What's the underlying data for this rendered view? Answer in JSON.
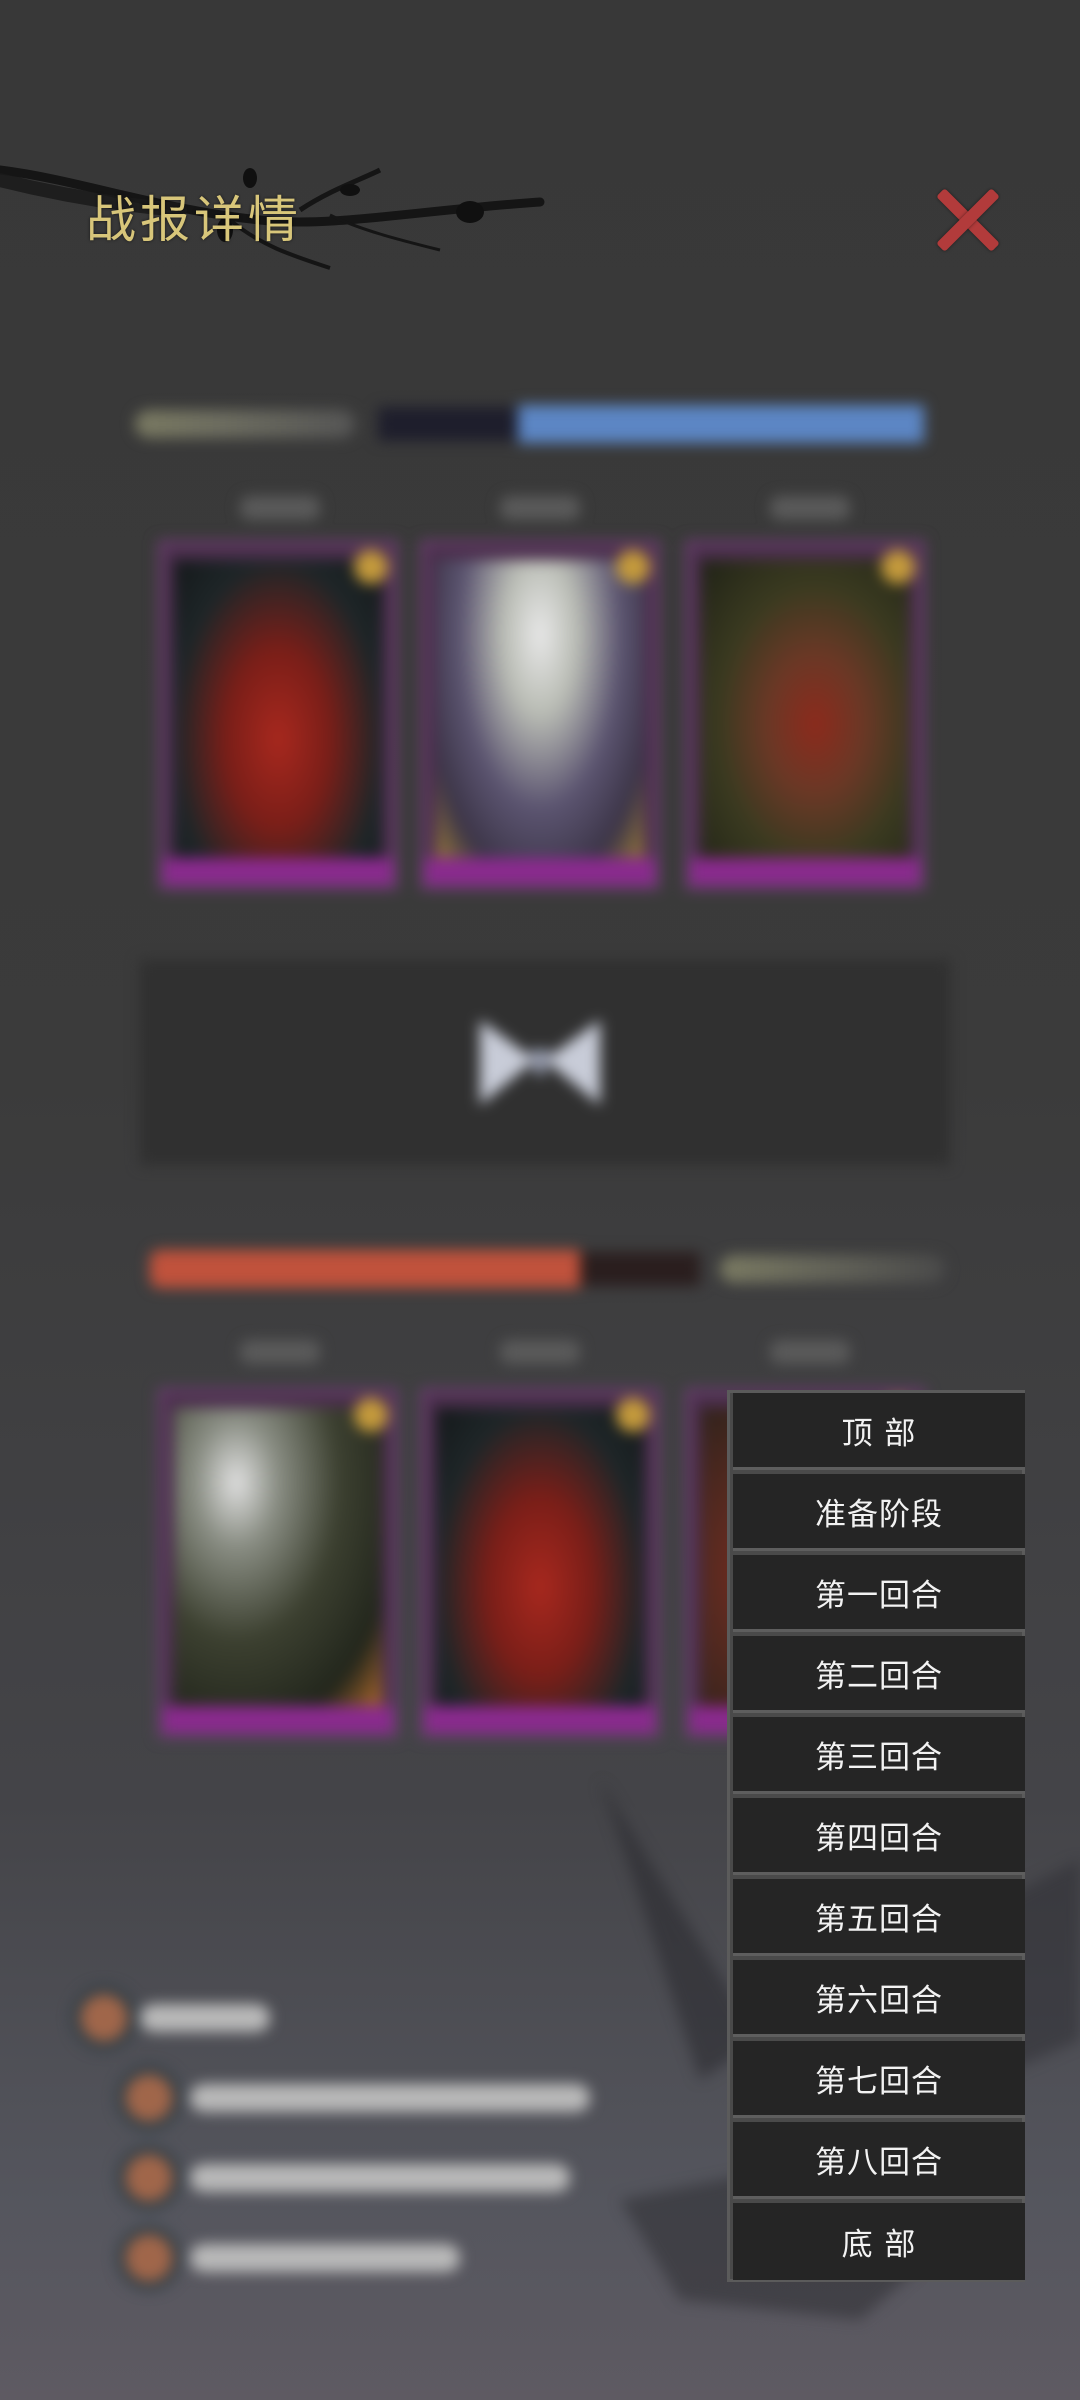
{
  "header": {
    "title": "战报详情",
    "close_icon": "close-icon",
    "close_color": "#b23b3b",
    "title_color": "#d8c67a"
  },
  "jump_menu": {
    "items": [
      {
        "label": "顶 部"
      },
      {
        "label": "准备阶段"
      },
      {
        "label": "第一回合"
      },
      {
        "label": "第二回合"
      },
      {
        "label": "第三回合"
      },
      {
        "label": "第四回合"
      },
      {
        "label": "第五回合"
      },
      {
        "label": "第六回合"
      },
      {
        "label": "第七回合"
      },
      {
        "label": "第八回合"
      },
      {
        "label": "底 部"
      }
    ]
  },
  "battle": {
    "top_team_hp_color": "#5c86c4",
    "bottom_team_hp_color": "#c0523c"
  }
}
